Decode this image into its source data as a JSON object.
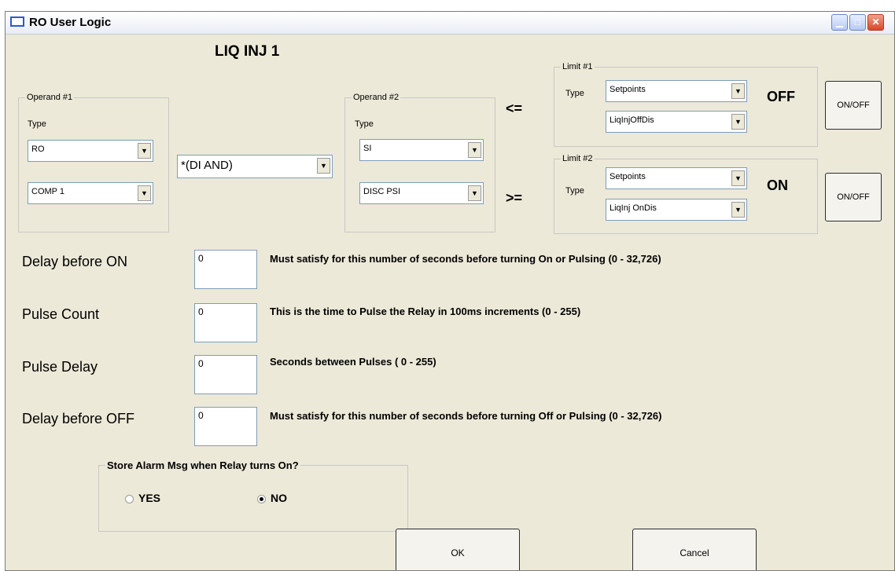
{
  "window": {
    "title": "RO User Logic"
  },
  "heading": "LIQ INJ 1",
  "operand1": {
    "legend": "Operand #1",
    "type_label": "Type",
    "type_value": "RO",
    "item_value": "COMP 1"
  },
  "operator": {
    "value": "*(DI AND)"
  },
  "operand2": {
    "legend": "Operand #2",
    "type_label": "Type",
    "type_value": "SI",
    "item_value": "DISC PSI"
  },
  "limit1": {
    "comparator": "<=",
    "legend": "Limit #1",
    "type_label": "Type",
    "type_value": "Setpoints",
    "item_value": "LiqInjOffDis",
    "state": "OFF",
    "button": "ON/OFF"
  },
  "limit2": {
    "comparator": ">=",
    "legend": "Limit #2",
    "type_label": "Type",
    "type_value": "Setpoints",
    "item_value": "LiqInj OnDis",
    "state": "ON",
    "button": "ON/OFF"
  },
  "rows": [
    {
      "label": "Delay before ON",
      "value": "0",
      "desc": "Must satisfy for this number of seconds before turning On or Pulsing (0 - 32,726)"
    },
    {
      "label": "Pulse Count",
      "value": "0",
      "desc": "This is the time to Pulse the Relay in 100ms increments (0 - 255)"
    },
    {
      "label": "Pulse Delay",
      "value": "0",
      "desc": "Seconds between Pulses ( 0 - 255)"
    },
    {
      "label": "Delay before OFF",
      "value": "0",
      "desc": "Must satisfy for this number of seconds before turning Off or Pulsing (0 - 32,726)"
    }
  ],
  "alarm": {
    "legend": "Store Alarm Msg when Relay turns On?",
    "yes": "YES",
    "no": "NO",
    "selected": "NO"
  },
  "buttons": {
    "ok": "OK",
    "cancel": "Cancel"
  },
  "icons": {
    "minimize": "minimize-icon",
    "maximize": "maximize-icon",
    "close": "close-icon",
    "dropdown": "chevron-down-icon"
  }
}
